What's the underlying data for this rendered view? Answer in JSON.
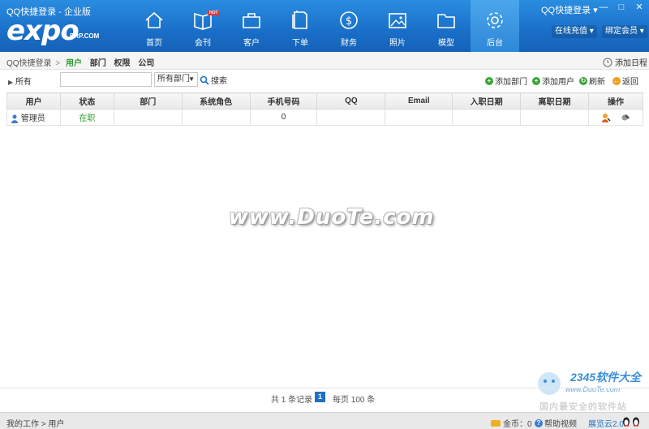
{
  "header": {
    "app_title": "QQ快捷登录 - 企业版",
    "logo": "expo",
    "logo_sub": "ERP.COM",
    "user_menu": "QQ快捷登录 ▾",
    "online_recharge": "在线充值",
    "bind_member": "绑定会员",
    "nav": [
      {
        "label": "首页",
        "icon": "home-icon"
      },
      {
        "label": "会刊",
        "icon": "book-icon",
        "badge": "HOT"
      },
      {
        "label": "客户",
        "icon": "briefcase-icon"
      },
      {
        "label": "下单",
        "icon": "document-icon"
      },
      {
        "label": "财务",
        "icon": "dollar-icon"
      },
      {
        "label": "照片",
        "icon": "picture-icon"
      },
      {
        "label": "模型",
        "icon": "folder-icon"
      },
      {
        "label": "后台",
        "icon": "gear-icon",
        "active": true
      }
    ],
    "window_controls": {
      "minimize": "—",
      "maximize": "□",
      "close": "✕"
    }
  },
  "subbar": {
    "root": "QQ快捷登录",
    "separator": ">",
    "tabs": [
      "用户",
      "部门",
      "权限",
      "公司"
    ],
    "active_tab": "用户",
    "add_schedule": "添加日程"
  },
  "toolbar": {
    "tree_toggle": "所有",
    "search_value": "",
    "department_select": "所有部门",
    "search_label": "搜索",
    "add_department": "添加部门",
    "add_user": "添加用户",
    "refresh": "刷新",
    "back": "返回"
  },
  "table": {
    "columns": [
      "用户",
      "状态",
      "部门",
      "系统角色",
      "手机号码",
      "QQ",
      "Email",
      "入职日期",
      "离职日期",
      "操作"
    ],
    "rows": [
      {
        "user": "管理员",
        "status": "在职",
        "department": "",
        "role": "",
        "phone": "0",
        "qq": "",
        "email": "",
        "hire_date": "",
        "leave_date": ""
      }
    ]
  },
  "watermark": "www.DuoTe.com",
  "pager": {
    "records": "共 1 条记录",
    "current_page": "1",
    "per_page": "每页 100 条"
  },
  "site_logo": {
    "brand": "2345软件大全",
    "url": "www.DuoTe.com",
    "slogan": "国内最安全的软件站"
  },
  "statusbar": {
    "crumb": "我的工作 > 用户",
    "coins": "金币：0",
    "help": "帮助视频",
    "version": "展览云2.0"
  },
  "colors": {
    "header_blue": "#1a6fc8",
    "active_green": "#2a9a2a",
    "page_blue": "#1f6fc7"
  }
}
